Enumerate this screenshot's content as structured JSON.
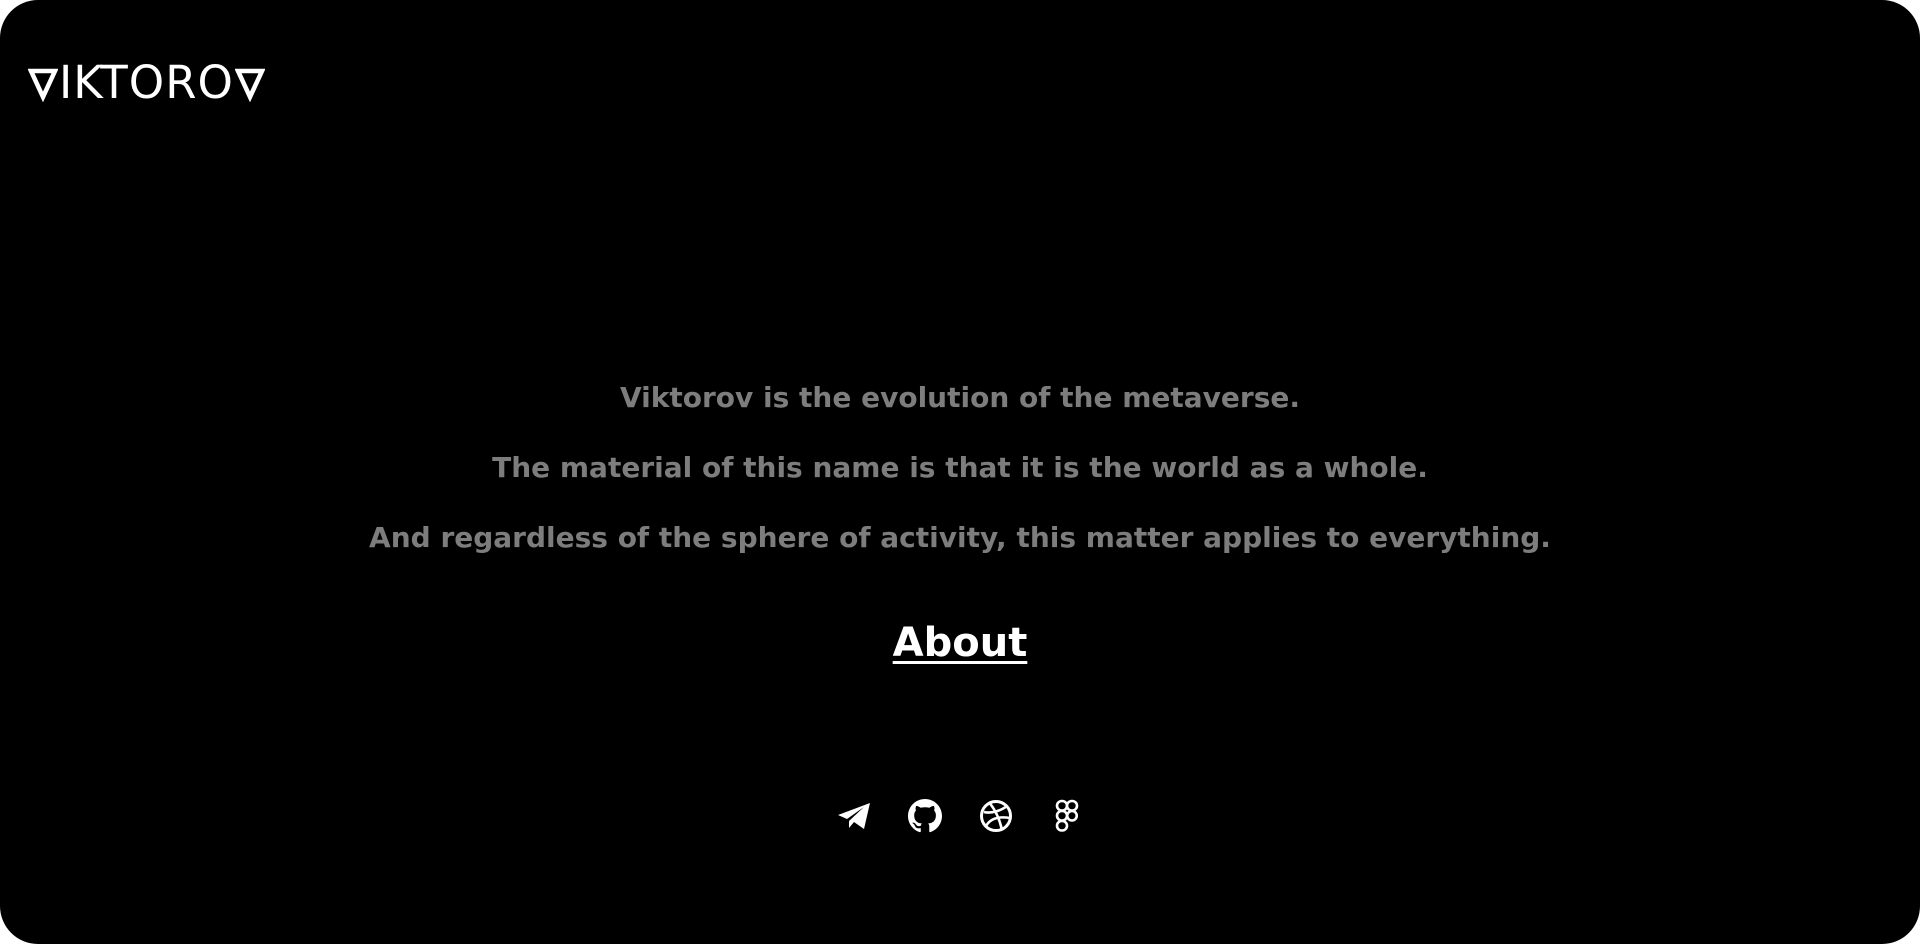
{
  "brand": {
    "name": "VIKTOROV",
    "logo_middle": "IKTORO"
  },
  "tagline": {
    "line1": "Viktorov is the evolution of the metaverse.",
    "line2": "The material of this name is that it is the world as a whole.",
    "line3": "And regardless of the sphere of activity, this matter applies to everything."
  },
  "about": {
    "label": "About"
  },
  "socials": [
    {
      "icon": "telegram-icon"
    },
    {
      "icon": "github-icon"
    },
    {
      "icon": "dribbble-icon"
    },
    {
      "icon": "figma-icon"
    }
  ],
  "colors": {
    "background": "#000000",
    "text_primary": "#ffffff",
    "text_muted": "#7d7d7d"
  }
}
